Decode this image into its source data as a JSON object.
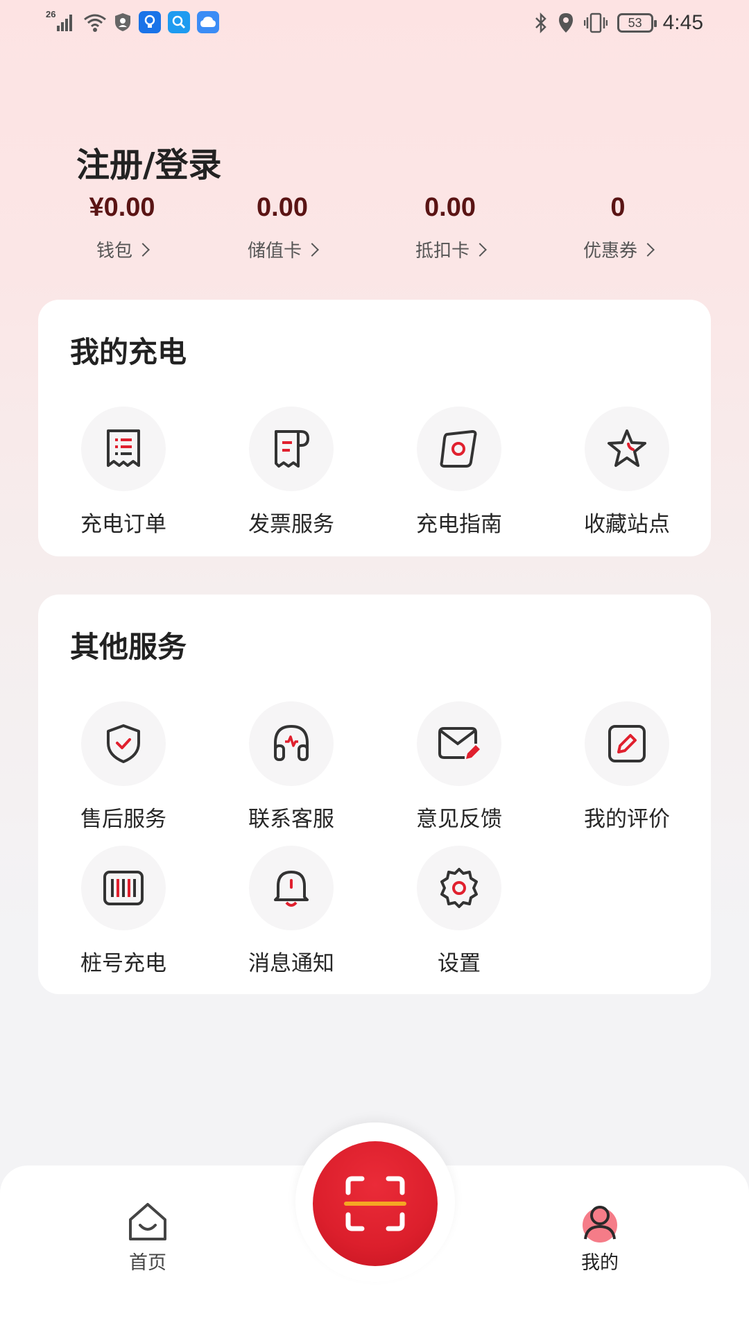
{
  "status_bar": {
    "network": "26",
    "battery": "53",
    "time": "4:45"
  },
  "profile": {
    "login_label": "注册/登录",
    "stats": [
      {
        "value": "¥0.00",
        "label": "钱包"
      },
      {
        "value": "0.00",
        "label": "储值卡"
      },
      {
        "value": "0.00",
        "label": "抵扣卡"
      },
      {
        "value": "0",
        "label": "优惠券"
      }
    ]
  },
  "my_charging": {
    "title": "我的充电",
    "items": [
      {
        "label": "充电订单",
        "icon": "order-receipt-icon"
      },
      {
        "label": "发票服务",
        "icon": "invoice-icon"
      },
      {
        "label": "充电指南",
        "icon": "guide-icon"
      },
      {
        "label": "收藏站点",
        "icon": "star-icon"
      }
    ]
  },
  "other_services": {
    "title": "其他服务",
    "items": [
      {
        "label": "售后服务",
        "icon": "shield-check-icon"
      },
      {
        "label": "联系客服",
        "icon": "headset-icon"
      },
      {
        "label": "意见反馈",
        "icon": "feedback-mail-icon"
      },
      {
        "label": "我的评价",
        "icon": "edit-review-icon"
      },
      {
        "label": "桩号充电",
        "icon": "barcode-icon"
      },
      {
        "label": "消息通知",
        "icon": "bell-icon"
      },
      {
        "label": "设置",
        "icon": "gear-icon"
      }
    ]
  },
  "bottom_nav": {
    "home_label": "首页",
    "mine_label": "我的",
    "scan_icon": "scan-icon"
  },
  "colors": {
    "accent": "#e0202e",
    "stat_value": "#5a1414",
    "scan_line": "#f5a623"
  }
}
